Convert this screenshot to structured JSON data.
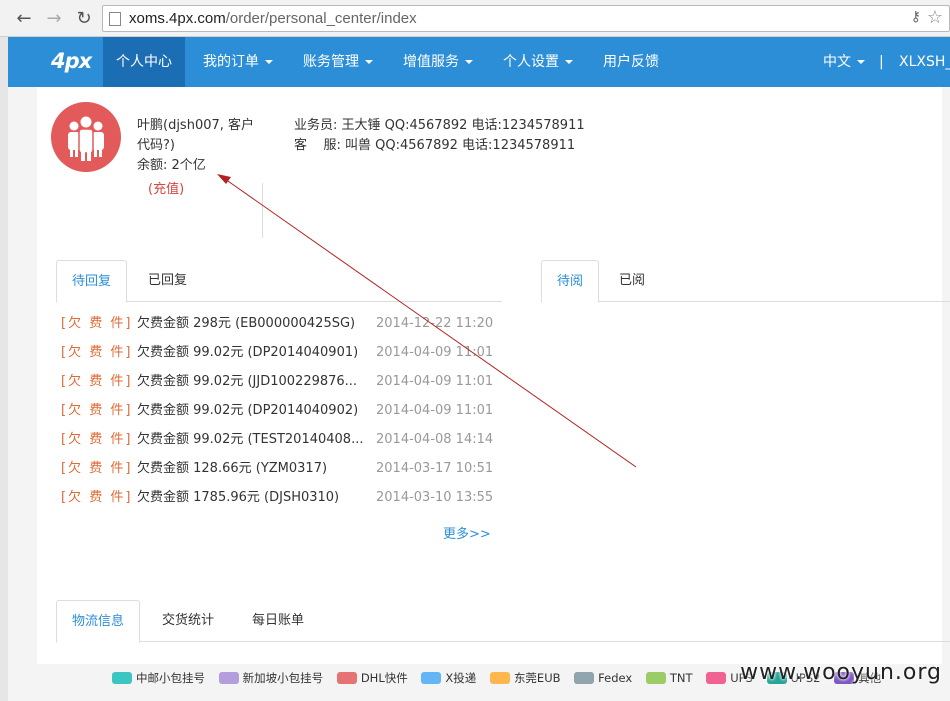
{
  "browser": {
    "url_host": "xoms.4px.com",
    "url_path": "/order/personal_center/index"
  },
  "topnav": {
    "logo": "4px",
    "items": [
      {
        "label": "个人中心",
        "active": true,
        "dropdown": false
      },
      {
        "label": "我的订单",
        "active": false,
        "dropdown": true
      },
      {
        "label": "账务管理",
        "active": false,
        "dropdown": true
      },
      {
        "label": "增值服务",
        "active": false,
        "dropdown": true
      },
      {
        "label": "个人设置",
        "active": false,
        "dropdown": true
      },
      {
        "label": "用户反馈",
        "active": false,
        "dropdown": false
      }
    ],
    "language": "中文",
    "separator": "|",
    "user": "XLXSH_"
  },
  "profile": {
    "name_line1": "叶鹏(djsh007, 客户",
    "name_line2": "代码?)",
    "balance": "余额: 2个亿",
    "recharge": "(充值)",
    "salesman": "业务员: 王大锤 QQ:4567892 电话:1234578911",
    "service": "客    服: 叫兽 QQ:4567892 电话:1234578911"
  },
  "messages_tabs": {
    "left": [
      "待回复",
      "已回复"
    ],
    "right": [
      "待阅",
      "已阅"
    ]
  },
  "messages": [
    {
      "tag": "[欠 费 件]",
      "text": "欠费金额 298元 (EB000000425SG)",
      "time": "2014-12-22 11:20"
    },
    {
      "tag": "[欠 费 件]",
      "text": "欠费金额 99.02元 (DP2014040901)",
      "time": "2014-04-09 11:01"
    },
    {
      "tag": "[欠 费 件]",
      "text": "欠费金额 99.02元 (JJD100229876...",
      "time": "2014-04-09 11:01"
    },
    {
      "tag": "[欠 费 件]",
      "text": "欠费金额 99.02元 (DP2014040902)",
      "time": "2014-04-09 11:01"
    },
    {
      "tag": "[欠 费 件]",
      "text": "欠费金额 99.02元 (TEST20140408...",
      "time": "2014-04-08 14:14"
    },
    {
      "tag": "[欠 费 件]",
      "text": "欠费金额 128.66元 (YZM0317)",
      "time": "2014-03-17 10:51"
    },
    {
      "tag": "[欠 费 件]",
      "text": "欠费金额 1785.96元 (DJSH0310)",
      "time": "2014-03-10 13:55"
    }
  ],
  "more_link": "更多>>",
  "bottom_tabs": [
    "物流信息",
    "交货统计",
    "每日账单"
  ],
  "legend": [
    {
      "label": "中邮小包挂号",
      "color": "#3cc6c2"
    },
    {
      "label": "新加坡小包挂号",
      "color": "#b39ddb"
    },
    {
      "label": "DHL快件",
      "color": "#e57373"
    },
    {
      "label": "X投递",
      "color": "#64b5f6"
    },
    {
      "label": "东莞EUB",
      "color": "#ffb74d"
    },
    {
      "label": "Fedex",
      "color": "#90a4ae"
    },
    {
      "label": "TNT",
      "color": "#9ccc65"
    },
    {
      "label": "UPS",
      "color": "#f06292"
    },
    {
      "label": "UPS2",
      "color": "#26a69a"
    },
    {
      "label": "其他",
      "color": "#7e57c2"
    }
  ],
  "watermark": "www.wooyun.org",
  "colors": {
    "nav_bg": "#2c8ed7",
    "nav_active": "#1b6db4",
    "avatar_bg": "#e25a5a",
    "tag_color": "#e06a35",
    "arrow_color": "#b22222"
  }
}
